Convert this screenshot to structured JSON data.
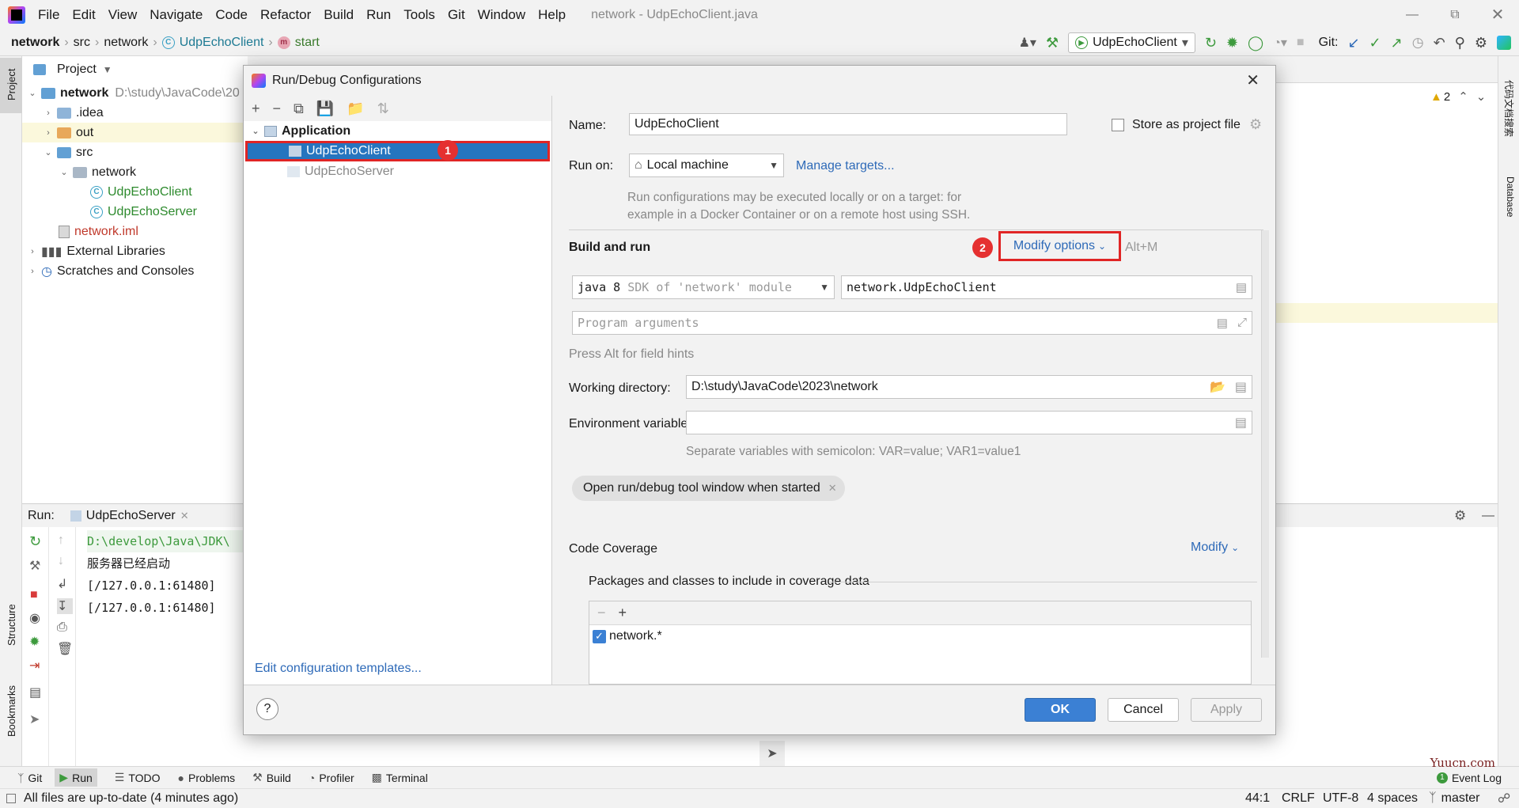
{
  "menubar": {
    "items": [
      "File",
      "Edit",
      "View",
      "Navigate",
      "Code",
      "Refactor",
      "Build",
      "Run",
      "Tools",
      "Git",
      "Window",
      "Help"
    ],
    "window_title": "network - UdpEchoClient.java"
  },
  "navbar": {
    "crumbs": [
      "network",
      "src",
      "network",
      "UdpEchoClient",
      "start"
    ],
    "run_config": "UdpEchoClient",
    "git_label": "Git:"
  },
  "stripe": {
    "project": "Project",
    "structure": "Structure",
    "bookmarks": "Bookmarks",
    "right_plugin": "代码文档搜索",
    "database": "Database"
  },
  "project": {
    "header": "Project",
    "root_name": "network",
    "root_path": "D:\\study\\JavaCode\\20",
    "items": [
      ".idea",
      "out",
      "src",
      "network",
      "UdpEchoClient",
      "UdpEchoServer",
      "network.iml",
      "External Libraries",
      "Scratches and Consoles"
    ]
  },
  "editor": {
    "warning_count": "2"
  },
  "run": {
    "label": "Run:",
    "tab": "UdpEchoServer",
    "lines": [
      "D:\\develop\\Java\\JDK\\",
      "服务器已经启动",
      "[/127.0.0.1:61480] ",
      "[/127.0.0.1:61480] "
    ]
  },
  "dialog": {
    "title": "Run/Debug Configurations",
    "tree": {
      "group": "Application",
      "items": [
        "UdpEchoClient",
        "UdpEchoServer"
      ]
    },
    "edit_templates": "Edit configuration templates...",
    "markers": [
      "1",
      "2"
    ],
    "name_label": "Name:",
    "name_value": "UdpEchoClient",
    "store_label": "Store as project file",
    "run_on_label": "Run on:",
    "run_on_value": "Local machine",
    "manage_targets": "Manage targets...",
    "run_on_hint_1": "Run configurations may be executed locally or on a target: for",
    "run_on_hint_2": "example in a Docker Container or on a remote host using SSH.",
    "build_run": "Build and run",
    "modify_options": "Modify options",
    "modify_shortcut": "Alt+M",
    "sdk_java": "java 8",
    "sdk_desc": "SDK of 'network' module",
    "main_class": "network.UdpEchoClient",
    "program_args_placeholder": "Program arguments",
    "field_hint": "Press Alt for field hints",
    "working_dir_label": "Working directory:",
    "working_dir_value": "D:\\study\\JavaCode\\2023\\network",
    "env_label": "Environment variables:",
    "env_hint": "Separate variables with semicolon: VAR=value; VAR1=value1",
    "chip": "Open run/debug tool window when started",
    "coverage_label": "Code Coverage",
    "coverage_modify": "Modify",
    "packages_label": "Packages and classes to include in coverage data",
    "package_item": "network.*",
    "ok": "OK",
    "cancel": "Cancel",
    "apply": "Apply",
    "help": "?"
  },
  "bottom_tools": [
    "Git",
    "Run",
    "TODO",
    "Problems",
    "Build",
    "Profiler",
    "Terminal"
  ],
  "event_log": "Event Log",
  "status": {
    "message": "All files are up-to-date (4 minutes ago)",
    "position": "44:1",
    "line_sep": "CRLF",
    "encoding": "UTF-8",
    "indent": "4 spaces",
    "branch": "master"
  },
  "watermark": "Yuucn.com",
  "colors": {
    "accent": "#2f65ca",
    "selection": "#2675bf",
    "marker": "#e53030",
    "link": "#2e6ab8"
  }
}
